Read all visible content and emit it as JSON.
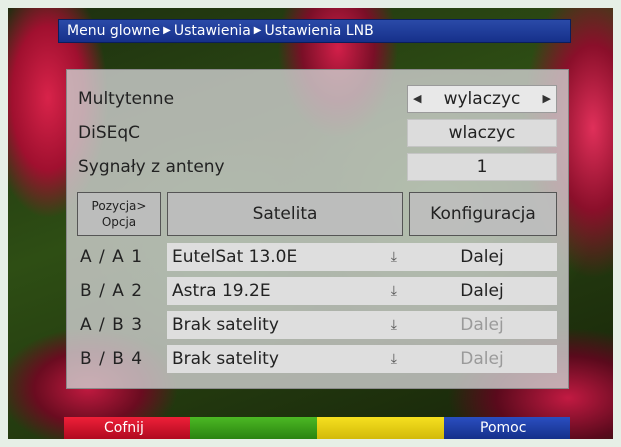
{
  "breadcrumb": {
    "item1": "Menu glowne",
    "item2": "Ustawienia",
    "item3": "Ustawienia LNB"
  },
  "settings": {
    "multytenne_label": "Multytenne",
    "multytenne_value": "wylaczyc",
    "diseqc_label": "DiSEqC",
    "diseqc_value": "wlaczyc",
    "signals_label": "Sygnały z anteny",
    "signals_value": "1"
  },
  "table": {
    "col_position_line1": "Pozycja>",
    "col_position_line2": "Opcja",
    "col_satellite": "Satelita",
    "col_config": "Konfiguracja",
    "rows": [
      {
        "position": "A / A   1",
        "satellite": "EutelSat 13.0E",
        "config": "Dalej",
        "enabled": true
      },
      {
        "position": "B / A   2",
        "satellite": "Astra 19.2E",
        "config": "Dalej",
        "enabled": true
      },
      {
        "position": "A / B   3",
        "satellite": "Brak satelity",
        "config": "Dalej",
        "enabled": false
      },
      {
        "position": "B / B   4",
        "satellite": "Brak satelity",
        "config": "Dalej",
        "enabled": false
      }
    ]
  },
  "footer": {
    "red_label": "Cofnij",
    "blue_label": "Pomoc"
  },
  "colors": {
    "red": "#d8102a",
    "green": "#3a9a1a",
    "yellow": "#e6d20c",
    "blue": "#1a3aa0",
    "disabled_text": "#9a9a9a"
  }
}
